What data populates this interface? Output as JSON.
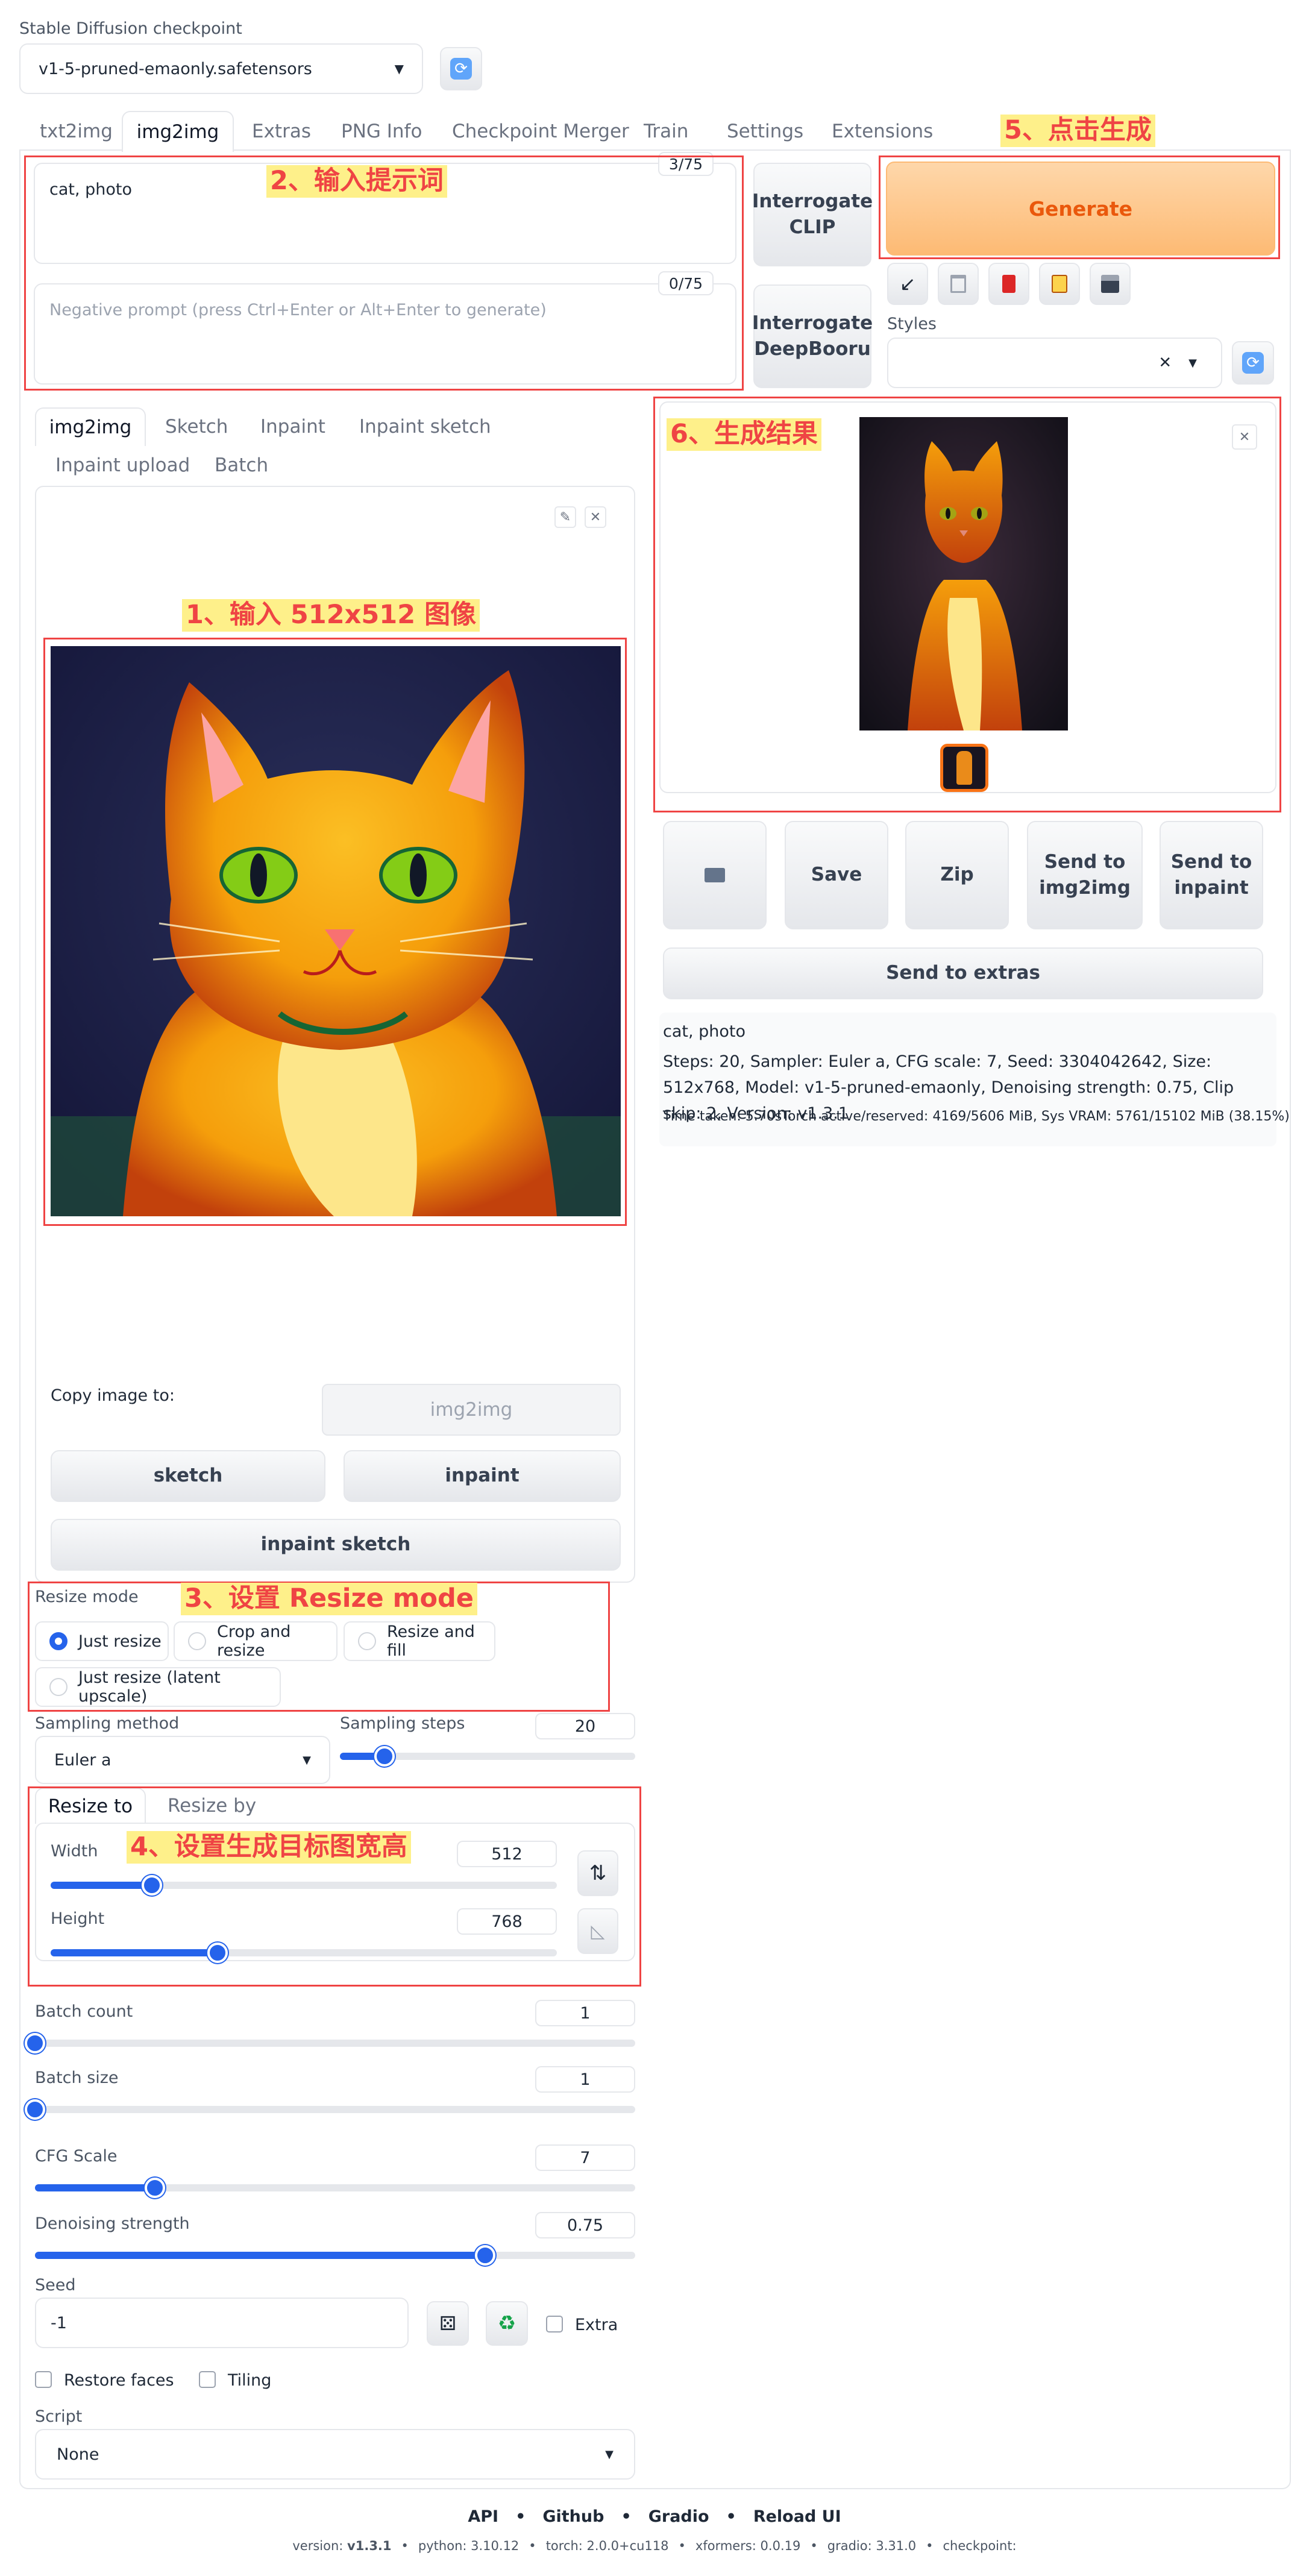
{
  "checkpoint": {
    "label": "Stable Diffusion checkpoint",
    "value": "v1-5-pruned-emaonly.safetensors"
  },
  "tabs": [
    "txt2img",
    "img2img",
    "Extras",
    "PNG Info",
    "Checkpoint Merger",
    "Train",
    "Settings",
    "Extensions"
  ],
  "prompt": {
    "value": "cat, photo",
    "count": "3/75"
  },
  "neg_prompt": {
    "placeholder": "Negative prompt (press Ctrl+Enter or Alt+Enter to generate)",
    "count": "0/75"
  },
  "interrogate": {
    "clip": "Interrogate CLIP",
    "deepbooru": "Interrogate DeepBooru"
  },
  "generate": "Generate",
  "styles_label": "Styles",
  "img_tabs": [
    "img2img",
    "Sketch",
    "Inpaint",
    "Inpaint sketch",
    "Inpaint upload",
    "Batch"
  ],
  "copy": {
    "label": "Copy image to:",
    "img2img": "img2img",
    "sketch": "sketch",
    "inpaint": "inpaint",
    "inpaint_sketch": "inpaint sketch"
  },
  "resize_mode": {
    "label": "Resize mode",
    "options": [
      "Just resize",
      "Crop and resize",
      "Resize and fill",
      "Just resize (latent upscale)"
    ],
    "selected": "Just resize"
  },
  "sampling": {
    "method_label": "Sampling method",
    "method": "Euler a",
    "steps_label": "Sampling steps",
    "steps": "20"
  },
  "resize_tabs": [
    "Resize to",
    "Resize by"
  ],
  "width": {
    "label": "Width",
    "value": "512"
  },
  "height": {
    "label": "Height",
    "value": "768"
  },
  "batch_count": {
    "label": "Batch count",
    "value": "1"
  },
  "batch_size": {
    "label": "Batch size",
    "value": "1"
  },
  "cfg": {
    "label": "CFG Scale",
    "value": "7"
  },
  "denoise": {
    "label": "Denoising strength",
    "value": "0.75"
  },
  "seed": {
    "label": "Seed",
    "value": "-1",
    "extra": "Extra"
  },
  "restore_faces": "Restore faces",
  "tiling": "Tiling",
  "script": {
    "label": "Script",
    "value": "None"
  },
  "output": {
    "buttons": {
      "save": "Save",
      "zip": "Zip",
      "send_img2img": "Send to img2img",
      "send_inpaint": "Send to inpaint",
      "send_extras": "Send to extras"
    },
    "info_prompt": "cat, photo",
    "info_params": "Steps: 20, Sampler: Euler a, CFG scale: 7, Seed: 3304042642, Size: 512x768, Model: v1-5-pruned-emaonly, Denoising strength: 0.75, Clip skip: 2, Version: v1.3.1",
    "info_time": "Time taken: 5.70sTorch active/reserved: 4169/5606 MiB, Sys VRAM: 5761/15102 MiB (38.15%)"
  },
  "annotations": {
    "a1": "1、输入 512x512 图像",
    "a2": "2、输入提示词",
    "a3": "3、设置 Resize mode",
    "a4": "4、设置生成目标图宽高",
    "a5": "5、点击生成",
    "a6": "6、生成结果"
  },
  "footer": {
    "links": [
      "API",
      "Github",
      "Gradio",
      "Reload UI"
    ],
    "version_label": "version:",
    "version": "v1.3.1",
    "python": "python: 3.10.12",
    "torch": "torch: 2.0.0+cu118",
    "xformers": "xformers: 0.0.19",
    "gradio": "gradio: 3.31.0",
    "checkpoint": "checkpoint:"
  },
  "levels": {
    "steps": 0.15,
    "width": 0.2,
    "height": 0.33,
    "batch_count": 0.0,
    "batch_size": 0.0,
    "cfg": 0.2,
    "denoise": 0.75
  },
  "colors": {
    "accent": "#2563eb",
    "generate": "#ea580c",
    "annotation_box": "#ef4444",
    "annotation_bg": "#fef08a"
  }
}
